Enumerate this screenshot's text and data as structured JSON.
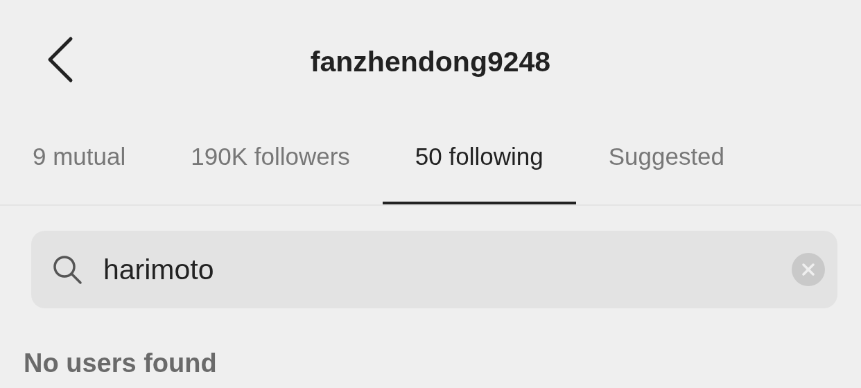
{
  "header": {
    "title": "fanzhendong9248"
  },
  "tabs": [
    {
      "label": "9 mutual",
      "selected": false
    },
    {
      "label": "190K followers",
      "selected": false
    },
    {
      "label": "50 following",
      "selected": true
    },
    {
      "label": "Suggested",
      "selected": false
    }
  ],
  "search": {
    "value": "harimoto"
  },
  "message": "No users found"
}
